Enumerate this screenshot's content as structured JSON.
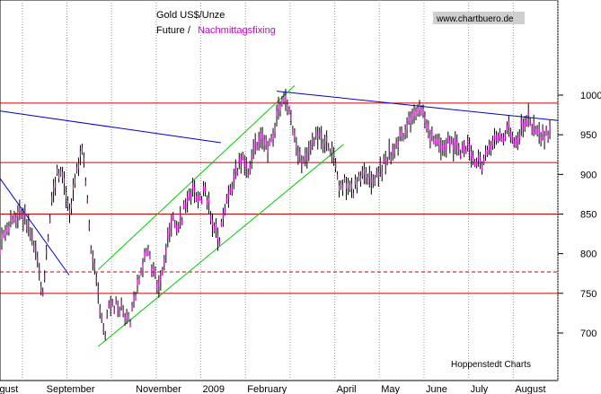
{
  "chart_data": {
    "type": "line",
    "title": "Gold US$/Unze",
    "subtitle_future": "Future /",
    "subtitle_fix": "Nachmittagsfixing",
    "watermark": "www.chartbuero.de",
    "source": "Hoppenstedt Charts",
    "ylim": [
      640,
      1120
    ],
    "xlim": [
      0,
      12.5
    ],
    "y_ticks": [
      700,
      750,
      800,
      850,
      900,
      950,
      1000
    ],
    "x_labels": [
      {
        "label": "August",
        "x": 0
      },
      {
        "label": "September",
        "x": 1
      },
      {
        "label": "November",
        "x": 3
      },
      {
        "label": "2009",
        "x": 4.5
      },
      {
        "label": "February",
        "x": 5.5
      },
      {
        "label": "April",
        "x": 7.5
      },
      {
        "label": "May",
        "x": 8.5
      },
      {
        "label": "June",
        "x": 9.5
      },
      {
        "label": "July",
        "x": 10.5
      },
      {
        "label": "August",
        "x": 11.5
      }
    ],
    "month_lines": [
      0.5,
      1.5,
      2.5,
      3.5,
      4.5,
      5.5,
      6.5,
      7.5,
      8.5,
      9.5,
      10.5,
      11.5,
      12.5
    ],
    "horizontal_levels": [
      {
        "value": 990,
        "style": "solid"
      },
      {
        "value": 915,
        "style": "solid"
      },
      {
        "value": 850,
        "style": "solid"
      },
      {
        "value": 777,
        "style": "dashed"
      },
      {
        "value": 750,
        "style": "solid"
      }
    ],
    "trendlines": [
      {
        "color": "#0000cc",
        "points": [
          [
            0,
            980
          ],
          [
            4.95,
            940
          ]
        ]
      },
      {
        "color": "#0000cc",
        "points": [
          [
            6.2,
            1005
          ],
          [
            12.5,
            968
          ]
        ]
      },
      {
        "color": "#0000cc",
        "points": [
          [
            0,
            895
          ],
          [
            1.55,
            773
          ]
        ]
      },
      {
        "color": "#00cc00",
        "points": [
          [
            2.2,
            780
          ],
          [
            6.6,
            1012
          ]
        ]
      },
      {
        "color": "#00cc00",
        "points": [
          [
            2.2,
            683
          ],
          [
            7.7,
            938
          ]
        ]
      }
    ],
    "series": [
      {
        "values": [
          [
            0.0,
            812
          ],
          [
            0.15,
            828
          ],
          [
            0.3,
            845
          ],
          [
            0.45,
            852
          ],
          [
            0.6,
            840
          ],
          [
            0.75,
            815
          ],
          [
            0.85,
            792
          ],
          [
            0.95,
            750
          ],
          [
            1.05,
            800
          ],
          [
            1.15,
            870
          ],
          [
            1.3,
            905
          ],
          [
            1.45,
            890
          ],
          [
            1.55,
            845
          ],
          [
            1.7,
            900
          ],
          [
            1.85,
            930
          ],
          [
            1.95,
            872
          ],
          [
            2.05,
            800
          ],
          [
            2.15,
            780
          ],
          [
            2.25,
            720
          ],
          [
            2.35,
            695
          ],
          [
            2.45,
            740
          ],
          [
            2.6,
            735
          ],
          [
            2.75,
            730
          ],
          [
            2.9,
            712
          ],
          [
            3.0,
            740
          ],
          [
            3.15,
            775
          ],
          [
            3.3,
            805
          ],
          [
            3.45,
            775
          ],
          [
            3.55,
            755
          ],
          [
            3.7,
            800
          ],
          [
            3.85,
            845
          ],
          [
            4.0,
            835
          ],
          [
            4.15,
            860
          ],
          [
            4.3,
            880
          ],
          [
            4.45,
            865
          ],
          [
            4.6,
            880
          ],
          [
            4.75,
            845
          ],
          [
            4.9,
            815
          ],
          [
            5.0,
            850
          ],
          [
            5.15,
            880
          ],
          [
            5.3,
            905
          ],
          [
            5.45,
            920
          ],
          [
            5.55,
            900
          ],
          [
            5.7,
            935
          ],
          [
            5.85,
            945
          ],
          [
            6.0,
            930
          ],
          [
            6.15,
            955
          ],
          [
            6.25,
            985
          ],
          [
            6.35,
            1000
          ],
          [
            6.45,
            985
          ],
          [
            6.55,
            960
          ],
          [
            6.65,
            925
          ],
          [
            6.8,
            915
          ],
          [
            6.95,
            935
          ],
          [
            7.1,
            950
          ],
          [
            7.25,
            940
          ],
          [
            7.4,
            935
          ],
          [
            7.5,
            915
          ],
          [
            7.6,
            885
          ],
          [
            7.75,
            890
          ],
          [
            7.9,
            880
          ],
          [
            8.05,
            895
          ],
          [
            8.2,
            905
          ],
          [
            8.35,
            890
          ],
          [
            8.5,
            900
          ],
          [
            8.65,
            920
          ],
          [
            8.8,
            930
          ],
          [
            8.95,
            945
          ],
          [
            9.1,
            958
          ],
          [
            9.25,
            975
          ],
          [
            9.4,
            985
          ],
          [
            9.5,
            970
          ],
          [
            9.6,
            950
          ],
          [
            9.75,
            940
          ],
          [
            9.9,
            935
          ],
          [
            10.05,
            942
          ],
          [
            10.2,
            935
          ],
          [
            10.35,
            928
          ],
          [
            10.5,
            935
          ],
          [
            10.65,
            920
          ],
          [
            10.8,
            910
          ],
          [
            10.95,
            930
          ],
          [
            11.1,
            945
          ],
          [
            11.25,
            950
          ],
          [
            11.4,
            955
          ],
          [
            11.55,
            940
          ],
          [
            11.7,
            958
          ],
          [
            11.85,
            970
          ],
          [
            11.95,
            960
          ],
          [
            12.05,
            952
          ],
          [
            12.2,
            948
          ],
          [
            12.35,
            952
          ]
        ]
      }
    ]
  }
}
